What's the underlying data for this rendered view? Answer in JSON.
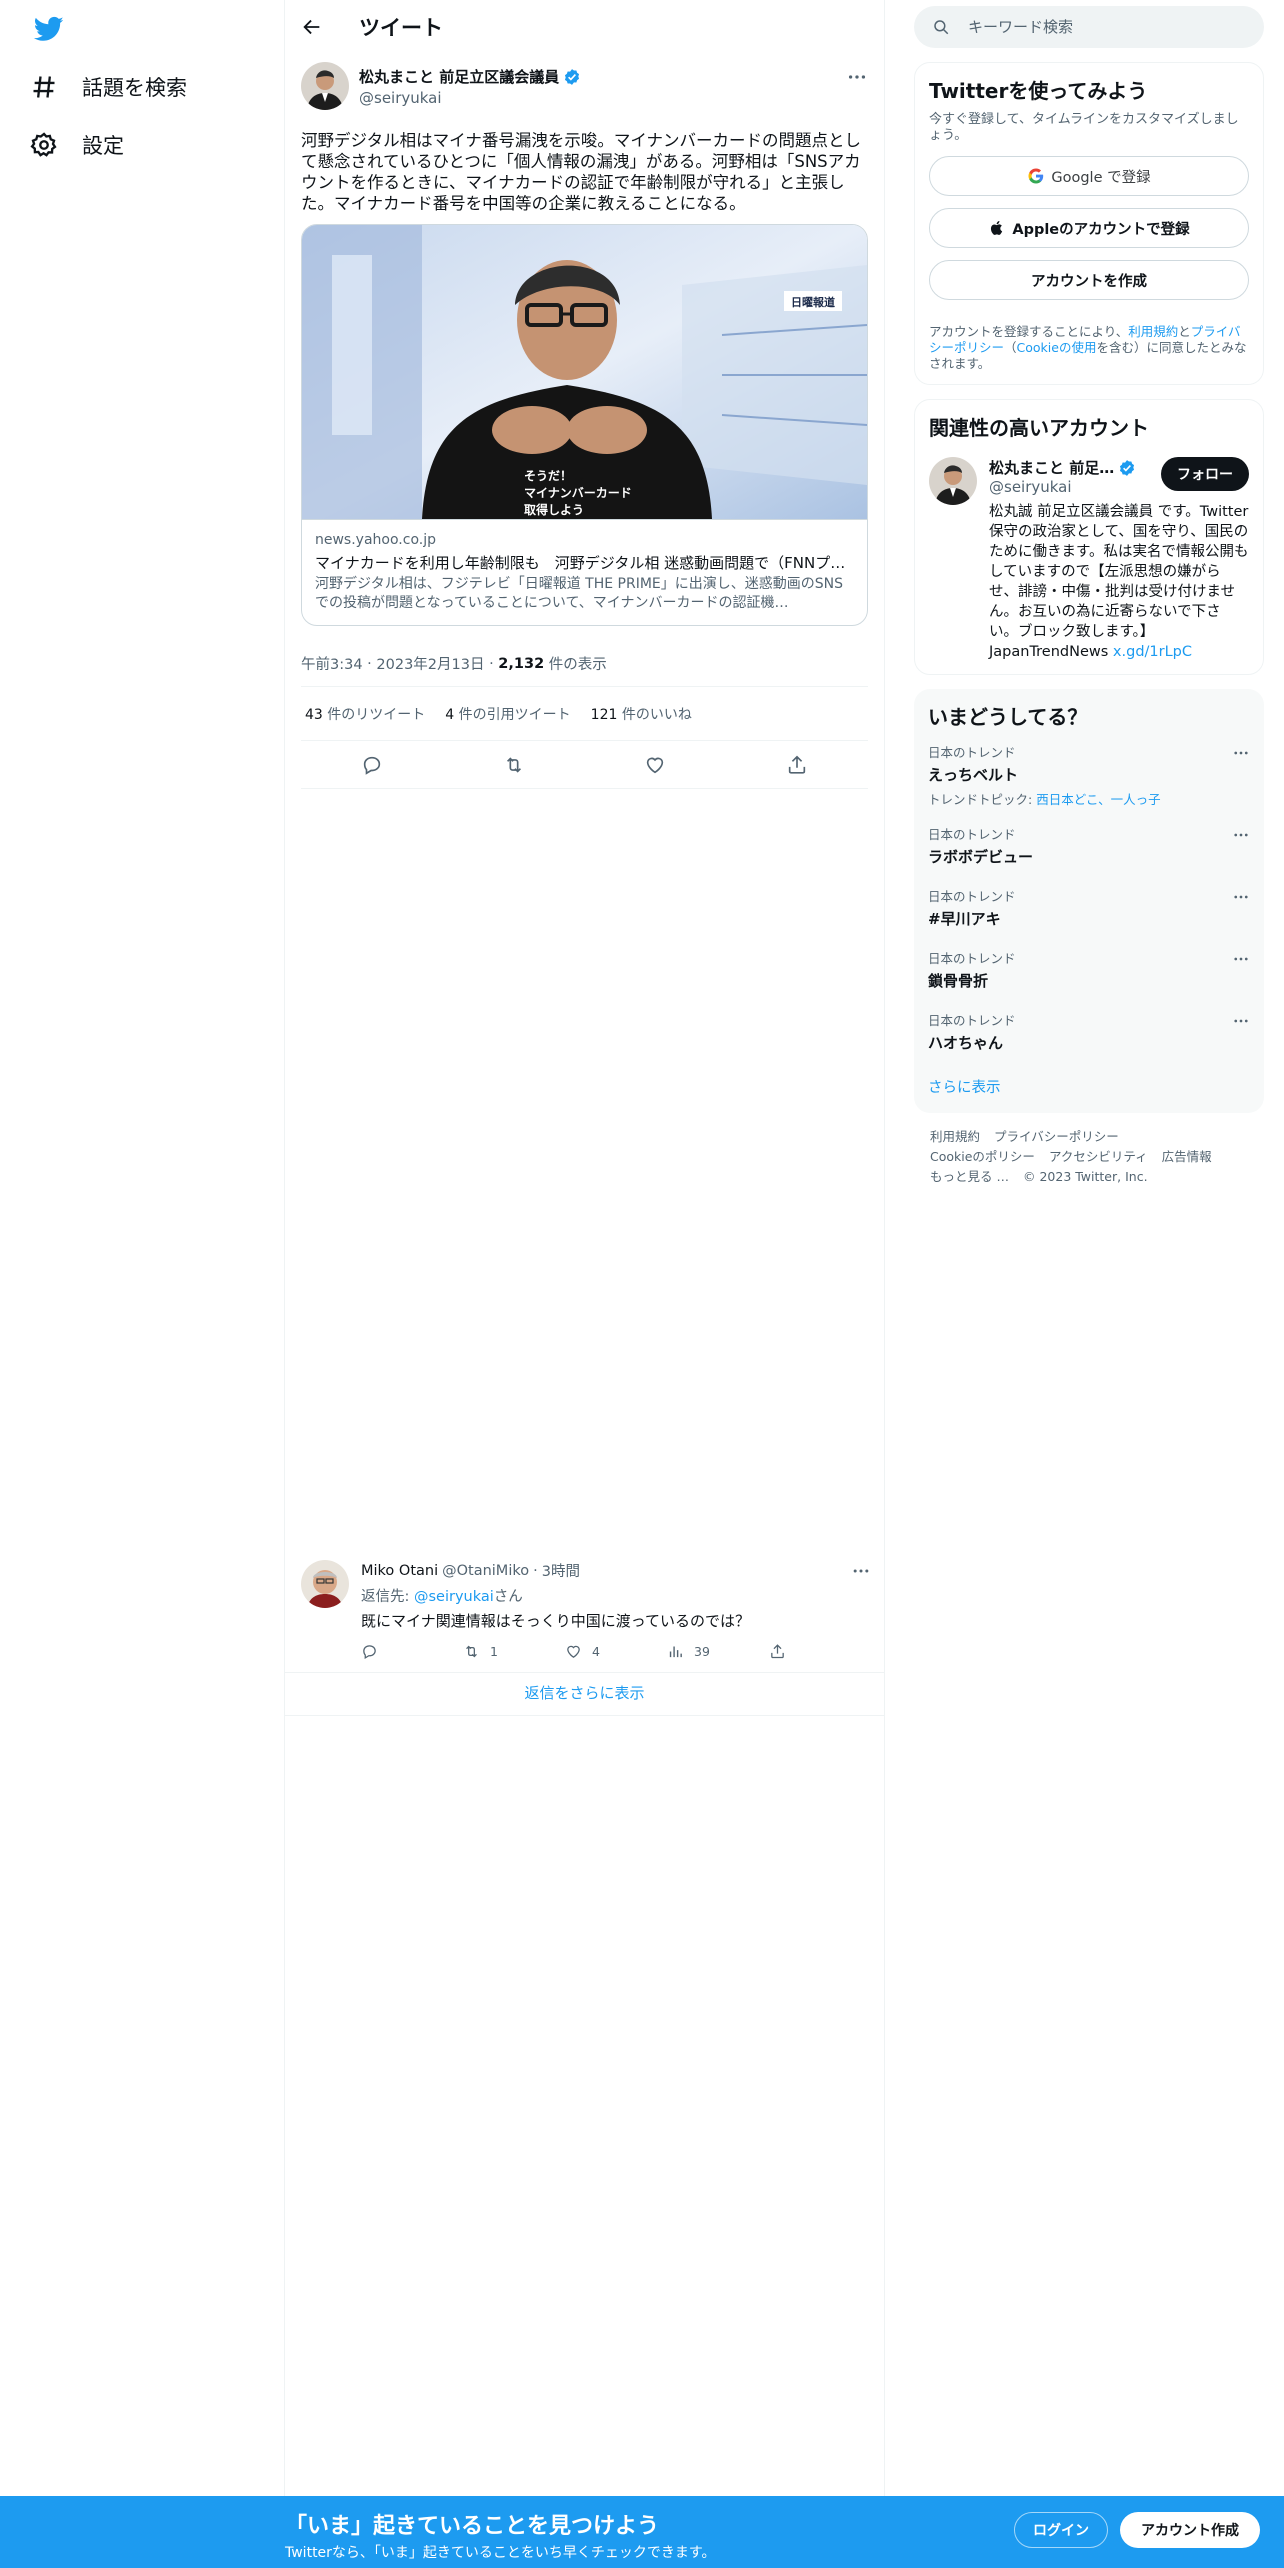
{
  "nav": {
    "items": [
      {
        "label": "話題を検索",
        "icon": "hashtag-icon"
      },
      {
        "label": "設定",
        "icon": "gear-icon"
      }
    ]
  },
  "header": {
    "title": "ツイート"
  },
  "tweet": {
    "author_name": "松丸まこと 前足立区議会議員",
    "author_handle": "@seiryukai",
    "text": "河野デジタル相はマイナ番号漏洩を示唆。マイナンバーカードの問題点として懸念されているひとつに「個人情報の漏洩」がある。河野相は「SNSアカウントを作るときに、マイナカードの認証で年齢制限が守れる」と主張した。マイナカード番号を中国等の企業に教えることになる。",
    "card": {
      "domain": "news.yahoo.co.jp",
      "title": "マイナカードを利用し年齢制限も　河野デジタル相 迷惑動画問題で（FNNプ…",
      "description": "河野デジタル相は、フジテレビ「日曜報道 THE PRIME」に出演し、迷惑動画のSNSでの投稿が問題となっていることについて、マイナンバーカードの認証機…",
      "image_caption_lines": [
        "そうだ！",
        "マイナンバーカード",
        "取得しよう"
      ],
      "image_logo": "日曜報道"
    },
    "time": "午前3:34",
    "date": "2023年2月13日",
    "views_count": "2,132",
    "views_label": "件の表示",
    "retweets_count": "43",
    "retweets_label": "件のリツイート",
    "quotes_count": "4",
    "quotes_label": "件の引用ツイート",
    "likes_count": "121",
    "likes_label": "件のいいね"
  },
  "reply": {
    "name": "Miko Otani",
    "handle": "@OtaniMiko",
    "time": "3時間",
    "reply_to_prefix": "返信先: ",
    "reply_to_handle": "@seiryukai",
    "reply_to_suffix": "さん",
    "text": "既にマイナ関連情報はそっくり中国に渡っているのでは？",
    "retweets": "1",
    "likes": "4",
    "views": "39"
  },
  "show_more_replies": "返信をさらに表示",
  "search": {
    "placeholder": "キーワード検索"
  },
  "signup": {
    "title": "Twitterを使ってみよう",
    "subtitle": "今すぐ登録して、タイムラインをカスタマイズしましょう。",
    "google_label": "Google で登録",
    "apple_label": "Appleのアカウントで登録",
    "create_label": "アカウントを作成",
    "terms_prefix": "アカウントを登録することにより、",
    "terms_link1": "利用規約",
    "terms_mid": "と",
    "terms_link2": "プライバシーポリシー",
    "terms_paren_open": "（",
    "terms_link3": "Cookieの使用",
    "terms_suffix": "を含む）に同意したとみなされます。"
  },
  "related": {
    "title": "関連性の高いアカウント",
    "name": "松丸まこと 前足…",
    "handle": "@seiryukai",
    "follow_label": "フォロー",
    "bio": "松丸誠 前足立区議会議員 です。Twitter保守の政治家として、国を守り、国民のために働きます。私は実名で情報公開もしていますので【左派思想の嫌がらせ、誹謗・中傷・批判は受け付けません。お互いの為に近寄らないで下さい。ブロック致します。】JapanTrendNews ",
    "bio_link": "x.gd/1rLpC"
  },
  "trends": {
    "title": "いまどうしてる？",
    "items": [
      {
        "category": "日本のトレンド",
        "name": "えっちベルト",
        "topic_prefix": "トレンドトピック: ",
        "topic_links": "西日本どこ、一人っ子"
      },
      {
        "category": "日本のトレンド",
        "name": "ラボボデビュー"
      },
      {
        "category": "日本のトレンド",
        "name": "#早川アキ"
      },
      {
        "category": "日本のトレンド",
        "name": "鎖骨骨折"
      },
      {
        "category": "日本のトレンド",
        "name": "ハオちゃん"
      }
    ],
    "show_more": "さらに表示"
  },
  "footer": {
    "terms": "利用規約",
    "privacy": "プライバシーポリシー",
    "cookie": "Cookieのポリシー",
    "accessibility": "アクセシビリティ",
    "ads": "広告情報",
    "more": "もっと見る …",
    "copyright": "© 2023 Twitter, Inc."
  },
  "bottom_bar": {
    "title": "「いま」起きていることを見つけよう",
    "subtitle": "Twitterなら、「いま」起きていることをいち早くチェックできます。",
    "login_label": "ログイン",
    "signup_label": "アカウント作成"
  },
  "colors": {
    "accent": "#1d9bf0",
    "text": "#0f1419",
    "secondary": "#536471",
    "border": "#eff3f4"
  }
}
